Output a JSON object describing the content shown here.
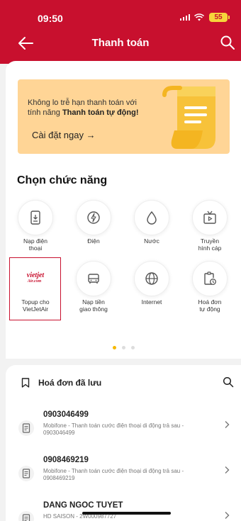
{
  "status_bar": {
    "time": "09:50",
    "battery": "55"
  },
  "header": {
    "title": "Thanh toán"
  },
  "banner": {
    "line1": "Không lo trễ hạn thanh toán với",
    "line2_prefix": "tính năng ",
    "line2_bold": "Thanh toán tự động!",
    "cta": "Cài đặt ngay →"
  },
  "section_title": "Chọn chức năng",
  "functions": [
    {
      "label": "Nạp điện\nthoại",
      "icon": "phone-topup-icon"
    },
    {
      "label": "Điện",
      "icon": "electricity-icon"
    },
    {
      "label": "Nước",
      "icon": "water-drop-icon"
    },
    {
      "label": "Truyền\nhình cáp",
      "icon": "tv-icon"
    },
    {
      "label": "Topup cho\nVietJetAir",
      "icon": "vietjet-logo",
      "logo_text": "vietjet",
      "logo_sub": "Air.com"
    },
    {
      "label": "Nạp tiền\ngiao thông",
      "icon": "car-icon"
    },
    {
      "label": "Internet",
      "icon": "globe-icon"
    },
    {
      "label": "Hoá đơn\ntự động",
      "icon": "auto-bill-icon"
    }
  ],
  "pager": {
    "pages": 3,
    "active": 1
  },
  "saved_bills": {
    "title": "Hoá đơn đã lưu",
    "items": [
      {
        "number": "0903046499",
        "desc": "Mobifone - Thanh toán cước điện thoại di động trả sau - 0903046499"
      },
      {
        "number": "0908469219",
        "desc": "Mobifone - Thanh toán cước điện thoại di động trả sau - 0908469219"
      },
      {
        "number": "DANG NGOC TUYET",
        "desc": "HD SAISON - 2W000987727"
      }
    ]
  },
  "colors": {
    "brand_red": "#c8102e",
    "banner_bg": "#ffd596",
    "pager_active": "#f6b800"
  }
}
